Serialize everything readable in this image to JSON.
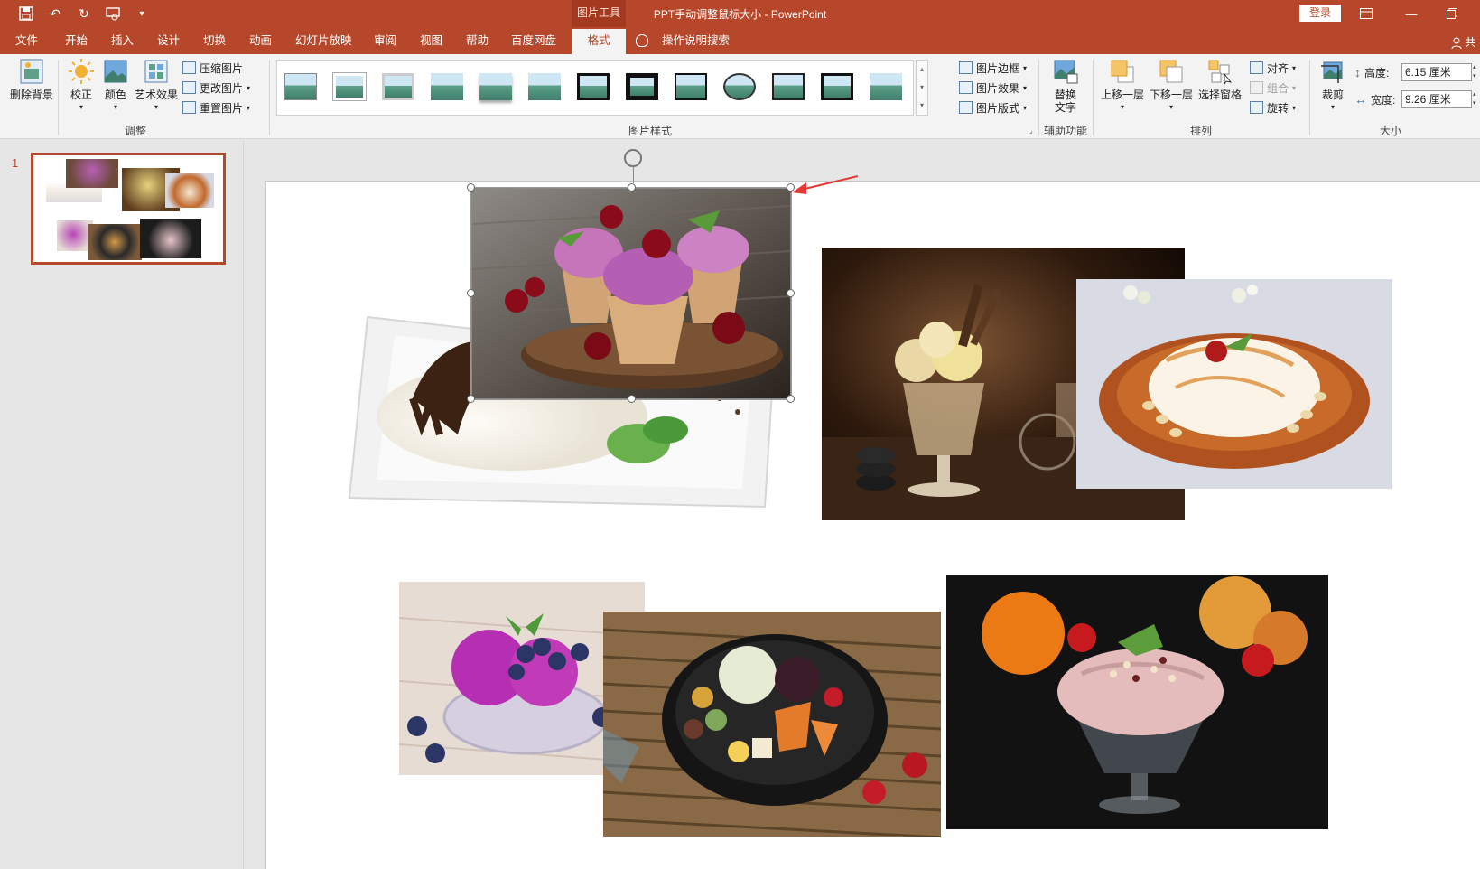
{
  "titlebar": {
    "context_tool": "图片工具",
    "doc_title": "PPT手动调整鼠标大小 - PowerPoint",
    "login": "登录"
  },
  "tabs": [
    "文件",
    "开始",
    "插入",
    "设计",
    "切换",
    "动画",
    "幻灯片放映",
    "审阅",
    "视图",
    "帮助",
    "百度网盘",
    "格式"
  ],
  "active_tab": "格式",
  "tell_me": "操作说明搜索",
  "share_label": "共",
  "ribbon": {
    "adjust": {
      "remove_bg": "删除背景",
      "corrections": "校正",
      "color": "颜色",
      "artistic": "艺术效果",
      "compress": "压缩图片",
      "change": "更改图片",
      "reset": "重置图片",
      "group_label": "调整"
    },
    "styles": {
      "border": "图片边框",
      "effects": "图片效果",
      "layout": "图片版式",
      "group_label": "图片样式"
    },
    "accessibility": {
      "alt_text_1": "替换",
      "alt_text_2": "文字",
      "group_label": "辅助功能"
    },
    "arrange": {
      "forward": "上移一层",
      "backward": "下移一层",
      "selection_pane": "选择窗格",
      "align": "对齐",
      "group": "组合",
      "rotate": "旋转",
      "group_label": "排列"
    },
    "size": {
      "crop": "裁剪",
      "height_label": "高度:",
      "height_value": "6.15 厘米",
      "width_label": "宽度:",
      "width_value": "9.26 厘米",
      "group_label": "大小"
    }
  },
  "thumbnail": {
    "slide_number": "1"
  },
  "colors": {
    "accent": "#b7472a",
    "ribbon_bg": "#f3f3f3",
    "pane_bg": "#e6e6e6",
    "arrow": "#e53935"
  },
  "slide_images": [
    "ice-cream-plate-chocolate",
    "ice-cream-cones-cherries",
    "sundae-glass-cookies",
    "shaved-ice-bowl-nuts",
    "purple-ice-cream-blueberries",
    "fruit-salad-bowl",
    "ice-cream-cup-oranges"
  ]
}
